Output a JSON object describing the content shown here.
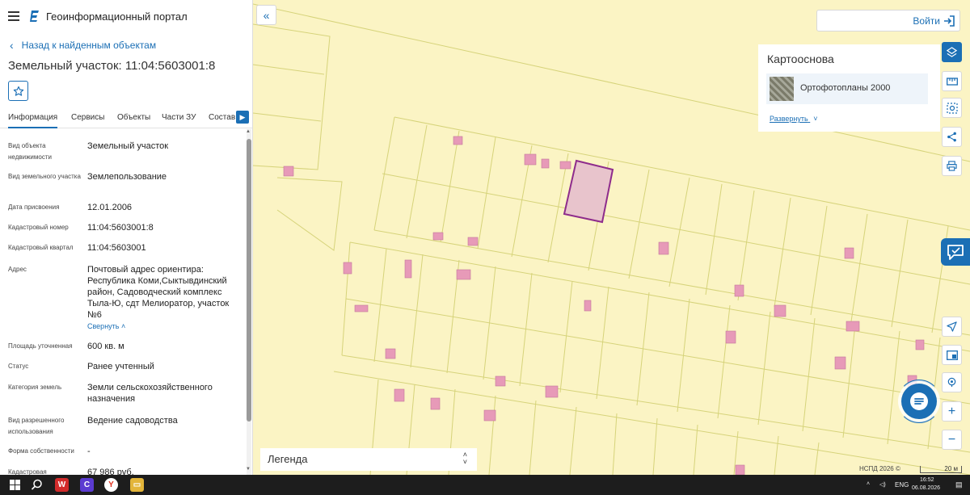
{
  "app": {
    "title": "Геоинформационный портал"
  },
  "nav": {
    "back_label": "Назад к найденным объектам"
  },
  "parcel": {
    "title": "Земельный участок: 11:04:5603001:8"
  },
  "tabs": [
    {
      "label": "Информация"
    },
    {
      "label": "Сервисы"
    },
    {
      "label": "Объекты"
    },
    {
      "label": "Части ЗУ"
    },
    {
      "label": "Состав"
    }
  ],
  "attributes": [
    {
      "label": "Вид объекта недвижимости",
      "value": "Земельный участок"
    },
    {
      "label": "Вид земельного участка",
      "value": "Землепользование"
    },
    {
      "label": "Дата присвоения",
      "value": "12.01.2006"
    },
    {
      "label": "Кадастровый номер",
      "value": "11:04:5603001:8"
    },
    {
      "label": "Кадастровый квартал",
      "value": "11:04:5603001"
    },
    {
      "label": "Адрес",
      "value": "Почтовый адрес ориентира: Республика Коми,Сыктывдинский район, Садоводческий комплекс Тыла-Ю, сдт Мелиоратор, участок №6",
      "link": "Свернуть"
    },
    {
      "label": "Площадь уточненная",
      "value": "600 кв. м"
    },
    {
      "label": "Статус",
      "value": "Ранее учтенный"
    },
    {
      "label": "Категория земель",
      "value": "Земли сельскохозяйственного назначения"
    },
    {
      "label": "Вид разрешенного использования",
      "value": "Ведение садоводства"
    },
    {
      "label": "Форма собственности",
      "value": "-"
    },
    {
      "label": "Кадастровая",
      "value": "67 986 руб."
    }
  ],
  "header": {
    "login_label": "Войти"
  },
  "basemap": {
    "title": "Картооснова",
    "selected": "Ортофотопланы 2000",
    "expand_label": "Развернуть"
  },
  "legend": {
    "label": "Легенда"
  },
  "map_footer": {
    "attribution": "НСПД 2026 ©",
    "scale": "20 м"
  },
  "taskbar": {
    "lang": "ENG",
    "time": "16:52",
    "date": "06.08.2026"
  },
  "colors": {
    "accent": "#1b6fb5",
    "map_background": "#fbf4c4",
    "parcel_line": "#d6d37a",
    "building_fill": "#e79ab8",
    "selected_parcel_stroke": "#8e2c8c",
    "selected_parcel_fill": "#e8c4cc"
  }
}
